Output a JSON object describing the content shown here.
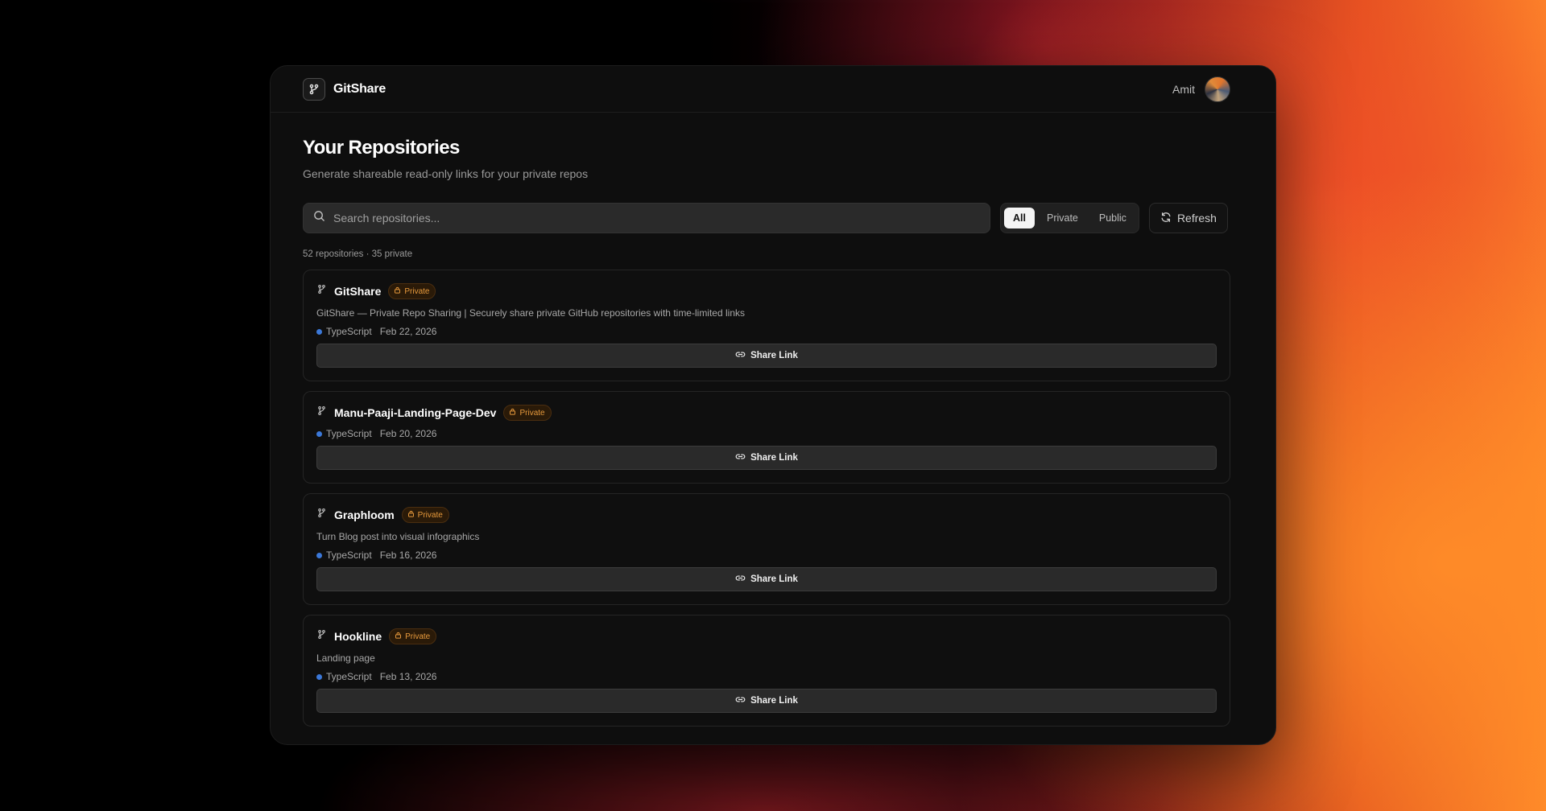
{
  "app": {
    "name": "GitShare",
    "user_name": "Amit"
  },
  "page": {
    "title": "Your Repositories",
    "subtitle": "Generate shareable read-only links for your private repos"
  },
  "search": {
    "placeholder": "Search repositories..."
  },
  "filters": {
    "tabs": [
      "All",
      "Private",
      "Public"
    ],
    "selected": "All"
  },
  "refresh_label": "Refresh",
  "repo_count_text": "52 repositories · 35 private",
  "colors": {
    "accent_private": "#e89a3c",
    "typescript_dot": "#3b78d8"
  },
  "repos": [
    {
      "name": "GitShare",
      "visibility": "Private",
      "description": "GitShare — Private Repo Sharing | Securely share private GitHub repositories with time-limited links",
      "language": "TypeScript",
      "date": "Feb 22, 2026",
      "share_label": "Share Link"
    },
    {
      "name": "Manu-Paaji-Landing-Page-Dev",
      "visibility": "Private",
      "description": "",
      "language": "TypeScript",
      "date": "Feb 20, 2026",
      "share_label": "Share Link"
    },
    {
      "name": "Graphloom",
      "visibility": "Private",
      "description": "Turn Blog post into visual infographics",
      "language": "TypeScript",
      "date": "Feb 16, 2026",
      "share_label": "Share Link"
    },
    {
      "name": "Hookline",
      "visibility": "Private",
      "description": "Landing page",
      "language": "TypeScript",
      "date": "Feb 13, 2026",
      "share_label": "Share Link"
    }
  ]
}
